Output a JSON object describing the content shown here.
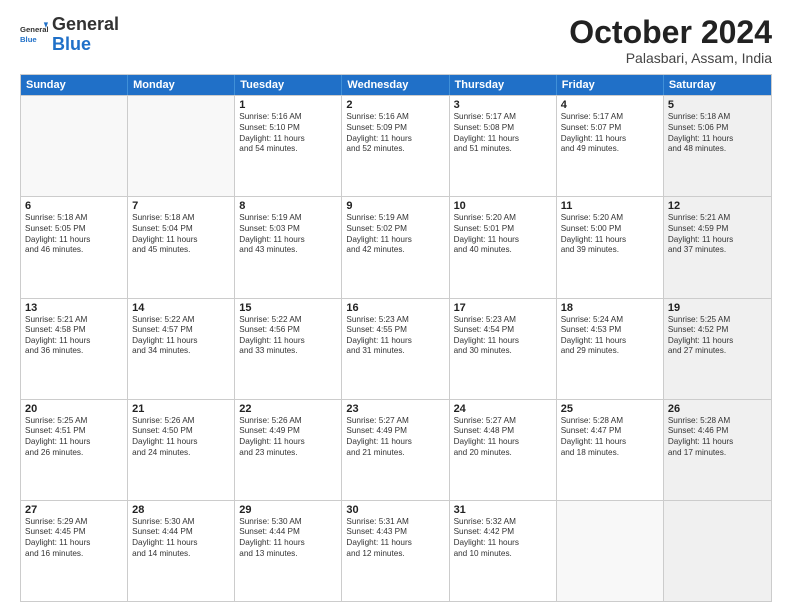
{
  "logo": {
    "general": "General",
    "blue": "Blue"
  },
  "title": "October 2024",
  "subtitle": "Palasbari, Assam, India",
  "headers": [
    "Sunday",
    "Monday",
    "Tuesday",
    "Wednesday",
    "Thursday",
    "Friday",
    "Saturday"
  ],
  "weeks": [
    [
      {
        "day": "",
        "empty": true
      },
      {
        "day": "",
        "empty": true
      },
      {
        "day": "1",
        "line1": "Sunrise: 5:16 AM",
        "line2": "Sunset: 5:10 PM",
        "line3": "Daylight: 11 hours",
        "line4": "and 54 minutes."
      },
      {
        "day": "2",
        "line1": "Sunrise: 5:16 AM",
        "line2": "Sunset: 5:09 PM",
        "line3": "Daylight: 11 hours",
        "line4": "and 52 minutes."
      },
      {
        "day": "3",
        "line1": "Sunrise: 5:17 AM",
        "line2": "Sunset: 5:08 PM",
        "line3": "Daylight: 11 hours",
        "line4": "and 51 minutes."
      },
      {
        "day": "4",
        "line1": "Sunrise: 5:17 AM",
        "line2": "Sunset: 5:07 PM",
        "line3": "Daylight: 11 hours",
        "line4": "and 49 minutes."
      },
      {
        "day": "5",
        "line1": "Sunrise: 5:18 AM",
        "line2": "Sunset: 5:06 PM",
        "line3": "Daylight: 11 hours",
        "line4": "and 48 minutes.",
        "shaded": true
      }
    ],
    [
      {
        "day": "6",
        "line1": "Sunrise: 5:18 AM",
        "line2": "Sunset: 5:05 PM",
        "line3": "Daylight: 11 hours",
        "line4": "and 46 minutes."
      },
      {
        "day": "7",
        "line1": "Sunrise: 5:18 AM",
        "line2": "Sunset: 5:04 PM",
        "line3": "Daylight: 11 hours",
        "line4": "and 45 minutes."
      },
      {
        "day": "8",
        "line1": "Sunrise: 5:19 AM",
        "line2": "Sunset: 5:03 PM",
        "line3": "Daylight: 11 hours",
        "line4": "and 43 minutes."
      },
      {
        "day": "9",
        "line1": "Sunrise: 5:19 AM",
        "line2": "Sunset: 5:02 PM",
        "line3": "Daylight: 11 hours",
        "line4": "and 42 minutes."
      },
      {
        "day": "10",
        "line1": "Sunrise: 5:20 AM",
        "line2": "Sunset: 5:01 PM",
        "line3": "Daylight: 11 hours",
        "line4": "and 40 minutes."
      },
      {
        "day": "11",
        "line1": "Sunrise: 5:20 AM",
        "line2": "Sunset: 5:00 PM",
        "line3": "Daylight: 11 hours",
        "line4": "and 39 minutes."
      },
      {
        "day": "12",
        "line1": "Sunrise: 5:21 AM",
        "line2": "Sunset: 4:59 PM",
        "line3": "Daylight: 11 hours",
        "line4": "and 37 minutes.",
        "shaded": true
      }
    ],
    [
      {
        "day": "13",
        "line1": "Sunrise: 5:21 AM",
        "line2": "Sunset: 4:58 PM",
        "line3": "Daylight: 11 hours",
        "line4": "and 36 minutes."
      },
      {
        "day": "14",
        "line1": "Sunrise: 5:22 AM",
        "line2": "Sunset: 4:57 PM",
        "line3": "Daylight: 11 hours",
        "line4": "and 34 minutes."
      },
      {
        "day": "15",
        "line1": "Sunrise: 5:22 AM",
        "line2": "Sunset: 4:56 PM",
        "line3": "Daylight: 11 hours",
        "line4": "and 33 minutes."
      },
      {
        "day": "16",
        "line1": "Sunrise: 5:23 AM",
        "line2": "Sunset: 4:55 PM",
        "line3": "Daylight: 11 hours",
        "line4": "and 31 minutes."
      },
      {
        "day": "17",
        "line1": "Sunrise: 5:23 AM",
        "line2": "Sunset: 4:54 PM",
        "line3": "Daylight: 11 hours",
        "line4": "and 30 minutes."
      },
      {
        "day": "18",
        "line1": "Sunrise: 5:24 AM",
        "line2": "Sunset: 4:53 PM",
        "line3": "Daylight: 11 hours",
        "line4": "and 29 minutes."
      },
      {
        "day": "19",
        "line1": "Sunrise: 5:25 AM",
        "line2": "Sunset: 4:52 PM",
        "line3": "Daylight: 11 hours",
        "line4": "and 27 minutes.",
        "shaded": true
      }
    ],
    [
      {
        "day": "20",
        "line1": "Sunrise: 5:25 AM",
        "line2": "Sunset: 4:51 PM",
        "line3": "Daylight: 11 hours",
        "line4": "and 26 minutes."
      },
      {
        "day": "21",
        "line1": "Sunrise: 5:26 AM",
        "line2": "Sunset: 4:50 PM",
        "line3": "Daylight: 11 hours",
        "line4": "and 24 minutes."
      },
      {
        "day": "22",
        "line1": "Sunrise: 5:26 AM",
        "line2": "Sunset: 4:49 PM",
        "line3": "Daylight: 11 hours",
        "line4": "and 23 minutes."
      },
      {
        "day": "23",
        "line1": "Sunrise: 5:27 AM",
        "line2": "Sunset: 4:49 PM",
        "line3": "Daylight: 11 hours",
        "line4": "and 21 minutes."
      },
      {
        "day": "24",
        "line1": "Sunrise: 5:27 AM",
        "line2": "Sunset: 4:48 PM",
        "line3": "Daylight: 11 hours",
        "line4": "and 20 minutes."
      },
      {
        "day": "25",
        "line1": "Sunrise: 5:28 AM",
        "line2": "Sunset: 4:47 PM",
        "line3": "Daylight: 11 hours",
        "line4": "and 18 minutes."
      },
      {
        "day": "26",
        "line1": "Sunrise: 5:28 AM",
        "line2": "Sunset: 4:46 PM",
        "line3": "Daylight: 11 hours",
        "line4": "and 17 minutes.",
        "shaded": true
      }
    ],
    [
      {
        "day": "27",
        "line1": "Sunrise: 5:29 AM",
        "line2": "Sunset: 4:45 PM",
        "line3": "Daylight: 11 hours",
        "line4": "and 16 minutes."
      },
      {
        "day": "28",
        "line1": "Sunrise: 5:30 AM",
        "line2": "Sunset: 4:44 PM",
        "line3": "Daylight: 11 hours",
        "line4": "and 14 minutes."
      },
      {
        "day": "29",
        "line1": "Sunrise: 5:30 AM",
        "line2": "Sunset: 4:44 PM",
        "line3": "Daylight: 11 hours",
        "line4": "and 13 minutes."
      },
      {
        "day": "30",
        "line1": "Sunrise: 5:31 AM",
        "line2": "Sunset: 4:43 PM",
        "line3": "Daylight: 11 hours",
        "line4": "and 12 minutes."
      },
      {
        "day": "31",
        "line1": "Sunrise: 5:32 AM",
        "line2": "Sunset: 4:42 PM",
        "line3": "Daylight: 11 hours",
        "line4": "and 10 minutes."
      },
      {
        "day": "",
        "empty": true
      },
      {
        "day": "",
        "empty": true,
        "shaded": true
      }
    ]
  ]
}
